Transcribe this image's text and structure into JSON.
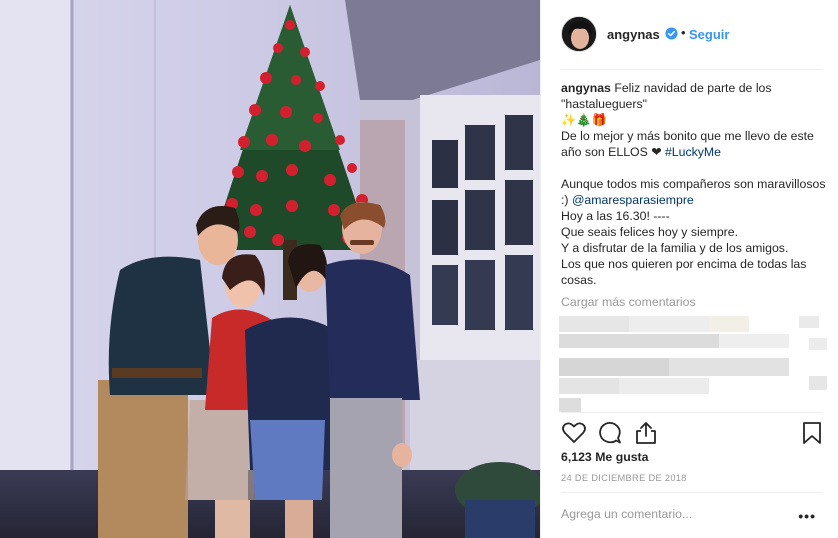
{
  "post": {
    "username": "angynas",
    "follow_label": "Seguir",
    "dot": "•",
    "caption": {
      "user": "angynas",
      "line1": "Feliz navidad de parte de los \"hastalueguers\"",
      "emoji": "✨🎄🎁",
      "line2": "De lo mejor y más bonito que me llevo de este año son ELLOS ❤",
      "hashtag": "#LuckyMe",
      "line3": "Aunque todos mis compañeros son maravillosos :)",
      "mention": "@amaresparasiempre",
      "line4": "Hoy a las 16.30! ----",
      "line5": "Que seais felices hoy y siempre.",
      "line6": "Y a disfrutar de la familia y de los amigos.",
      "line7": "Los que nos quieren por encima de todas las cosas."
    },
    "load_more": "Cargar más comentarios",
    "likes": "6,123 Me gusta",
    "date": "24 DE DICIEMBRE DE 2018",
    "comment_placeholder": "Agrega un comentario...",
    "options": "•••"
  },
  "colors": {
    "link": "#3897f0",
    "verified": "#3897f0",
    "text": "#262626",
    "muted": "#999999"
  },
  "icons": [
    "verified-badge-icon",
    "heart-icon",
    "comment-icon",
    "share-icon",
    "bookmark-icon",
    "more-options-icon"
  ]
}
